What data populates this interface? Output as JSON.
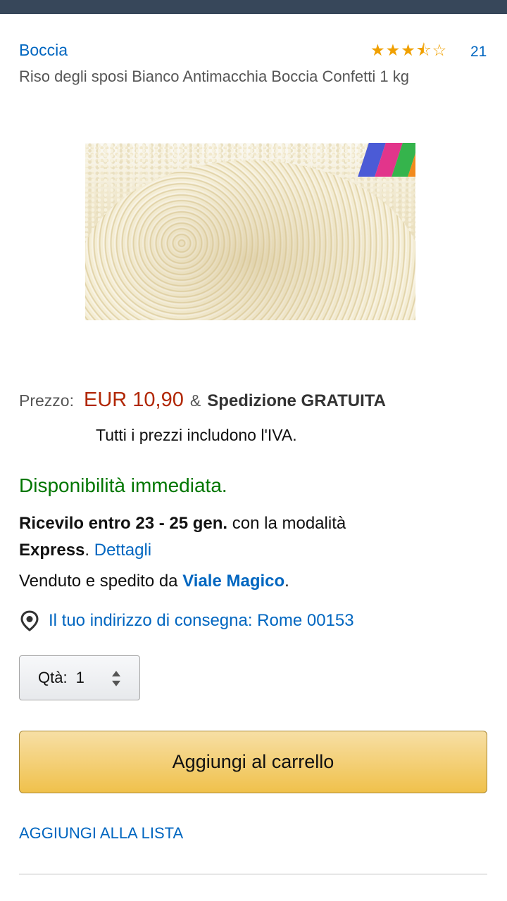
{
  "header": {
    "bar_color": "#37475a"
  },
  "product": {
    "brand": "Boccia",
    "rating": 3.5,
    "rating_max": 5,
    "review_count": "21",
    "title": "Riso degli sposi Bianco Antimacchia Boccia Confetti 1 kg"
  },
  "price": {
    "label": "Prezzo:",
    "value": "EUR 10,90",
    "amp": "&",
    "shipping": "Spedizione GRATUITA",
    "vat_note": "Tutti i prezzi includono l'IVA."
  },
  "availability": {
    "status": "Disponibilità immediata.",
    "receive_bold": "Ricevilo entro 23 - 25 gen.",
    "receive_rest": " con la modalità",
    "express": "Express",
    "period": ".",
    "details_link": "Dettagli"
  },
  "seller": {
    "prefix": "Venduto e spedito da ",
    "name": "Viale Magico",
    "suffix": "."
  },
  "address": {
    "icon": "location-pin-icon",
    "text": "Il tuo indirizzo di consegna: Rome 00153"
  },
  "quantity": {
    "label": "Qtà:",
    "value": "1"
  },
  "actions": {
    "add_to_cart": "Aggiungi al carrello",
    "add_to_list": "AGGIUNGI ALLA LISTA"
  },
  "colors": {
    "link": "#0066c0",
    "price": "#b12704",
    "in_stock": "#007600",
    "button": "#f0c14b",
    "star": "#f0a000"
  }
}
